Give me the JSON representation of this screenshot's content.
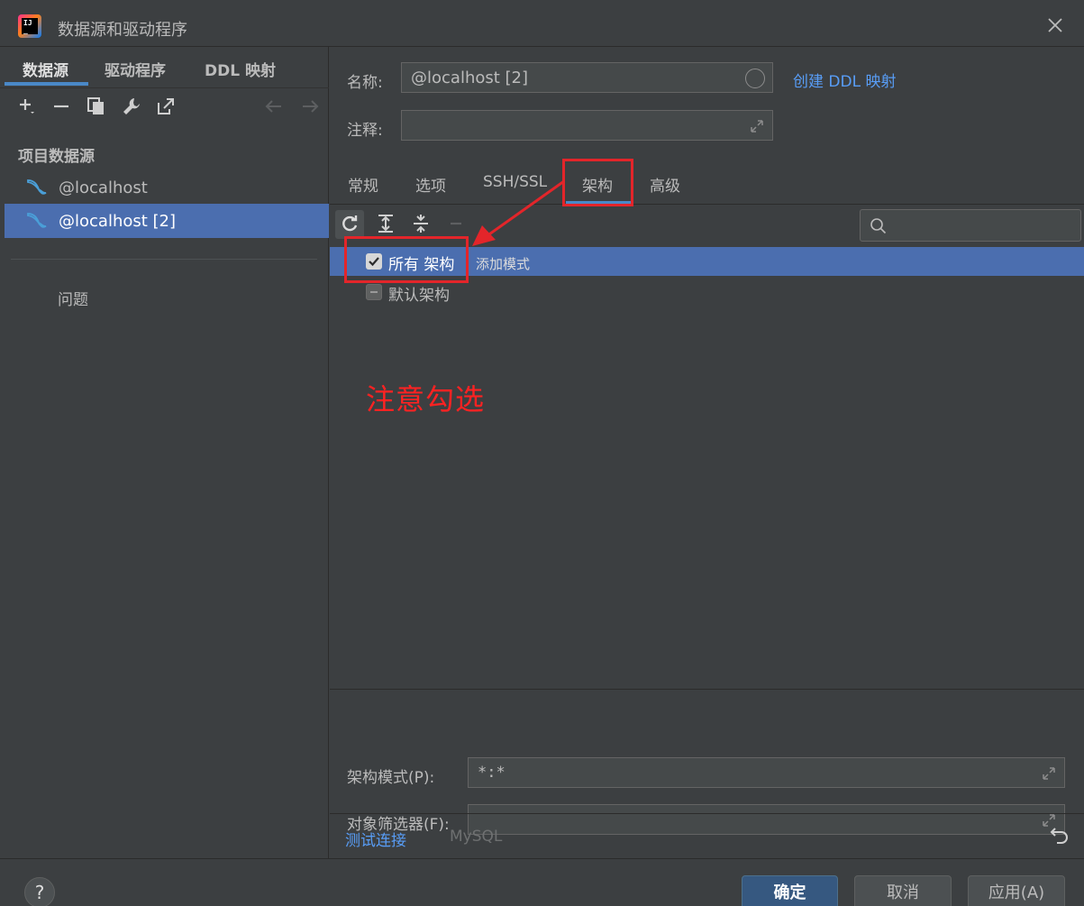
{
  "window": {
    "title": "数据源和驱动程序"
  },
  "left": {
    "tabs": [
      {
        "label": "数据源"
      },
      {
        "label": "驱动程序"
      },
      {
        "label": "DDL 映射"
      }
    ],
    "section_label": "项目数据源",
    "datasources": [
      {
        "label": "@localhost"
      },
      {
        "label": "@localhost [2]"
      }
    ],
    "problems_label": "问题"
  },
  "form": {
    "name_label": "名称:",
    "name_value": "@localhost [2]",
    "create_ddl_link": "创建 DDL 映射",
    "comment_label": "注释:",
    "comment_value": ""
  },
  "tabs": [
    {
      "label": "常规"
    },
    {
      "label": "选项"
    },
    {
      "label": "SSH/SSL"
    },
    {
      "label": "架构"
    },
    {
      "label": "高级"
    }
  ],
  "schemas": {
    "search_placeholder": "",
    "tree": [
      {
        "label": "所有 架构",
        "hint": "添加模式",
        "state": "checked"
      },
      {
        "label": "默认架构",
        "state": "indeterminate"
      }
    ]
  },
  "annotation": {
    "text": "注意勾选",
    "color": "#e3252a"
  },
  "bottom_fields": {
    "schema_pattern_label": "架构模式(P):",
    "schema_pattern_value": "*:*",
    "object_filter_label": "对象筛选器(F):",
    "object_filter_value": ""
  },
  "bottom_links": {
    "test_connection": "测试连接",
    "driver_name": "MySQL"
  },
  "footer": {
    "help": "?",
    "ok": "确定",
    "cancel": "取消",
    "apply": "应用(A)"
  },
  "colors": {
    "background": "#3c3f41",
    "selection": "#4b6eaf",
    "accent": "#4a88c7",
    "link": "#589df6"
  }
}
